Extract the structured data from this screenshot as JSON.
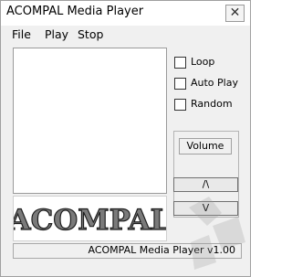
{
  "window": {
    "title": "ACOMPAL Media Player"
  },
  "menu": [
    {
      "label": "File"
    },
    {
      "label": "Play"
    },
    {
      "label": "Stop"
    }
  ],
  "options": [
    {
      "label": "Loop",
      "checked": false
    },
    {
      "label": "Auto Play",
      "checked": false
    },
    {
      "label": "Random",
      "checked": false
    }
  ],
  "volume": {
    "label": "Volume",
    "up_label": "/\\",
    "down_label": "V"
  },
  "logo": {
    "text": "ACOMPAL"
  },
  "status": {
    "text": "ACOMPAL Media Player v1.00"
  },
  "colors": {
    "window_bg": "#f0f0f0",
    "title_bg": "#ffffff",
    "logo_text": "#3a3a3a"
  }
}
